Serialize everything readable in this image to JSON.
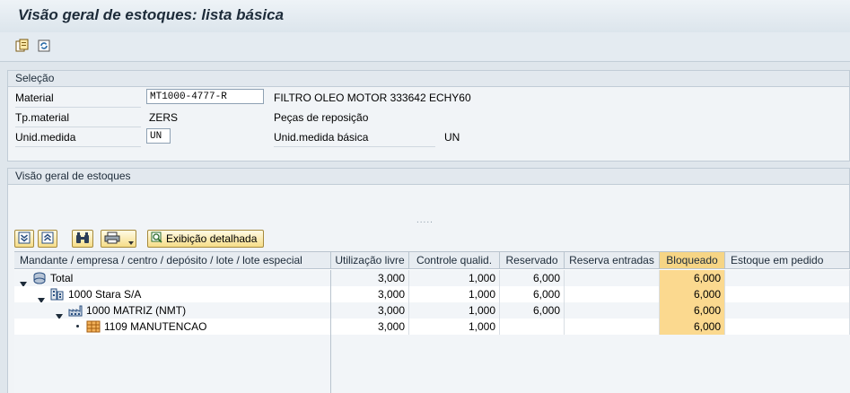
{
  "page": {
    "title": "Visão geral de estoques: lista básica"
  },
  "app_toolbar": {
    "items": [
      {
        "icon": "copy-document-icon"
      },
      {
        "icon": "refresh-icon"
      }
    ]
  },
  "selection": {
    "title": "Seleção",
    "material_label": "Material",
    "material_value": "MT1000-4777-R",
    "material_desc": "FILTRO OLEO MOTOR 333642 ECHY60",
    "tpmaterial_label": "Tp.material",
    "tpmaterial_value": "ZERS",
    "tpmaterial_desc": "Peças de reposição",
    "unid_label": "Unid.medida",
    "unid_value": "UN",
    "unid_basica_label": "Unid.medida básica",
    "unid_basica_value": "UN"
  },
  "overview": {
    "title": "Visão geral de estoques",
    "splitter": ".....",
    "toolbar": {
      "expand_icon": "expand-all-icon",
      "collapse_icon": "collapse-all-icon",
      "find_icon": "binoculars-icon",
      "print_icon": "printer-icon",
      "detail_label": "Exibição detalhada"
    },
    "columns": [
      "Mandante / empresa / centro / depósito / lote / lote especial",
      "Utilização livre",
      "Controle qualid.",
      "Reservado",
      "Reserva entradas",
      "Bloqueado",
      "Estoque em pedido"
    ],
    "rows": [
      {
        "label": "Total",
        "icon": "total-stock-icon",
        "livre": "3,000",
        "qualid": "1,000",
        "reservado": "6,000",
        "res_entradas": "",
        "bloqueado": "6,000",
        "pedido": ""
      },
      {
        "label": "1000 Stara S/A",
        "icon": "company-building-icon",
        "livre": "3,000",
        "qualid": "1,000",
        "reservado": "6,000",
        "res_entradas": "",
        "bloqueado": "6,000",
        "pedido": ""
      },
      {
        "label": "1000 MATRIZ (NMT)",
        "icon": "plant-factory-icon",
        "livre": "3,000",
        "qualid": "1,000",
        "reservado": "6,000",
        "res_entradas": "",
        "bloqueado": "6,000",
        "pedido": ""
      },
      {
        "label": "1109 MANUTENCAO",
        "icon": "storage-location-icon",
        "livre": "3,000",
        "qualid": "1,000",
        "reservado": "",
        "res_entradas": "",
        "bloqueado": "6,000",
        "pedido": ""
      }
    ]
  },
  "colors": {
    "blocked_highlight": "#fbd98f",
    "button_gold": "#f6dd88"
  }
}
